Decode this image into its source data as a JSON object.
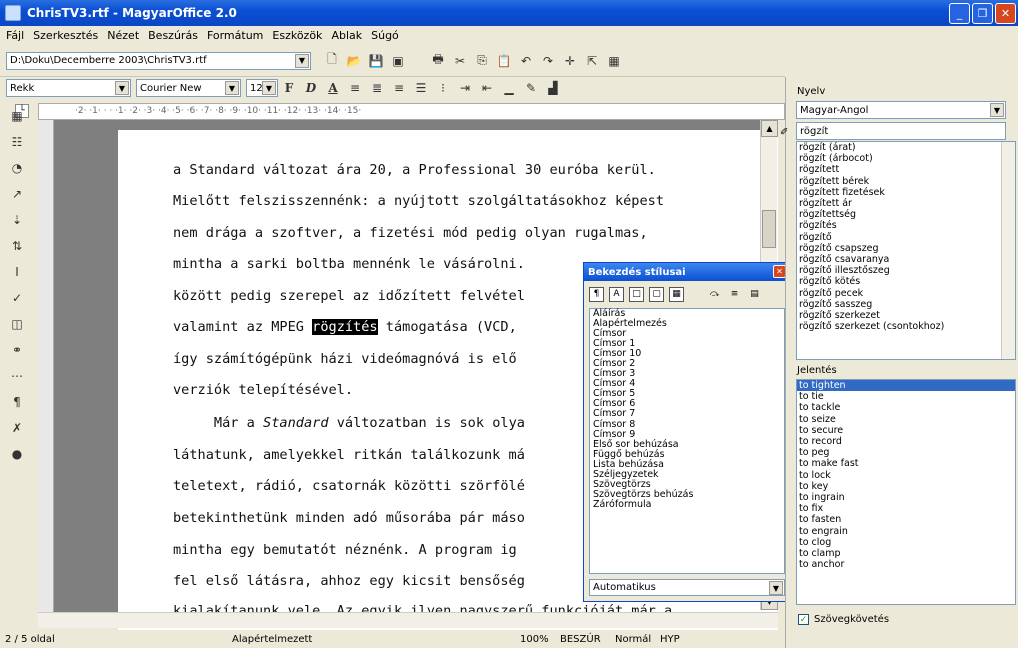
{
  "window": {
    "title": "ChrisTV3.rtf - MagyarOffice 2.0"
  },
  "menu": [
    "Fájl",
    "Szerkesztés",
    "Nézet",
    "Beszúrás",
    "Formátum",
    "Eszközök",
    "Ablak",
    "Súgó"
  ],
  "toolbar": {
    "path_value": "D:\\Doku\\Decemberre 2003\\ChrisTV3.rtf"
  },
  "format": {
    "style": "Rekk",
    "font": "Courier New",
    "size": "12",
    "bold": "F",
    "italic": "D",
    "underline": "A"
  },
  "ruler": {
    "text": "·2·  ·1·  ·   ·  ·1·  ·2·  ·3·  ·4·  ·5·  ·6·  ·7·  ·8·  ·9·  ·10·  ·11·  ·12·  ·13·  ·14·  ·15·"
  },
  "document": {
    "lines": [
      {
        "text": "a Standard változat ára 20, a Professional 30 euróba kerül."
      },
      {
        "text": "Mielőtt felszisszennénk: a nyújtott szolgáltatásokhoz képest"
      },
      {
        "text": "nem drága a szoftver, a fizetési mód pedig olyan rugalmas,"
      },
      {
        "text": "mintha a sarki boltba mennénk le vásárolni."
      },
      {
        "text": "között pedig szerepel az időzített felvétel"
      },
      {
        "before": "valamint az MPEG ",
        "selected": "rögzítés",
        "after": " támogatása (VCD,"
      },
      {
        "text": "így számítógépünk házi videómagnóvá is elő"
      },
      {
        "text": "verziók telepítésével."
      },
      {
        "before": "     Már a ",
        "italic": "Standard",
        "after": " változatban is sok olya"
      },
      {
        "text": "láthatunk, amelyekkel ritkán találkozunk má"
      },
      {
        "text": "teletext, rádió, csatornák közötti szörfölé"
      },
      {
        "text": "betekinthetünk minden adó műsorába pár máso"
      },
      {
        "text": "mintha egy bemutatót néznénk. A program ig"
      },
      {
        "text": "fel első látásra, ahhoz egy kicsit bensőség"
      },
      {
        "text": "kialakítanunk vele. Az egyik ilyen nagyszerű funkcióját már a"
      }
    ]
  },
  "dialog": {
    "title": "Bekezdés stílusai",
    "items": [
      "Aláírás",
      "Alapértelmezés",
      "Címsor",
      "Címsor 1",
      "Címsor 10",
      "Címsor 2",
      "Címsor 3",
      "Címsor 4",
      "Címsor 5",
      "Címsor 6",
      "Címsor 7",
      "Címsor 8",
      "Címsor 9",
      "Első sor behúzása",
      "Függő behúzás",
      "Lista behúzása",
      "Széljegyzetek",
      "Szövegtörzs",
      "Szövegtörzs behúzás",
      "Záróformula"
    ],
    "select_value": "Automatikus"
  },
  "panel": {
    "language_label": "Nyelv",
    "language_value": "Magyar-Angol",
    "search_value": "rögzít",
    "words": [
      "rögzít (árat)",
      "rögzít (árbocot)",
      "rögzített",
      "rögzített bérek",
      "rögzített fizetések",
      "rögzített ár",
      "rögzítettség",
      "rögzítés",
      "rögzítő",
      "rögzítő csapszeg",
      "rögzítő csavaranya",
      "rögzítő illesztőszeg",
      "rögzítő kötés",
      "rögzítő pecek",
      "rögzítő sasszeg",
      "rögzítő szerkezet",
      "rögzítő szerkezet (csontokhoz)"
    ],
    "meaning_label": "Jelentés",
    "meanings": [
      "to tighten",
      "to tie",
      "to tackle",
      "to seize",
      "to secure",
      "to record",
      "to peg",
      "to make fast",
      "to lock",
      "to key",
      "to ingrain",
      "to fix",
      "to fasten",
      "to engrain",
      "to clog",
      "to clamp",
      "to anchor"
    ],
    "checkbox_label": "Szövegkövetés"
  },
  "status": {
    "page": "2 / 5 oldal",
    "style": "Alapértelmezett",
    "zoom": "100%",
    "ins": "BESZÚR",
    "mode": "Normál",
    "hyp": "HYP"
  }
}
